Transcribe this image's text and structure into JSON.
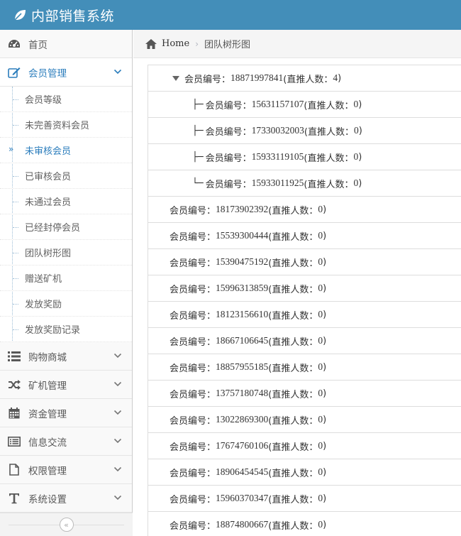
{
  "app": {
    "title": "内部销售系统"
  },
  "sidebar": {
    "items": [
      {
        "key": "dashboard",
        "label": "首页",
        "icon": "tachometer-icon"
      },
      {
        "key": "member",
        "label": "会员管理",
        "icon": "edit-icon",
        "open": true,
        "children": [
          {
            "label": "会员等级"
          },
          {
            "label": "未完善资料会员"
          },
          {
            "label": "未审核会员",
            "active": true
          },
          {
            "label": "已审核会员"
          },
          {
            "label": "未通过会员"
          },
          {
            "label": "已经封停会员"
          },
          {
            "label": "团队树形图"
          },
          {
            "label": "赠送矿机"
          },
          {
            "label": "发放奖励"
          },
          {
            "label": "发放奖励记录"
          }
        ]
      },
      {
        "key": "shop",
        "label": "购物商城",
        "icon": "list-icon"
      },
      {
        "key": "miner",
        "label": "矿机管理",
        "icon": "random-icon"
      },
      {
        "key": "funds",
        "label": "资金管理",
        "icon": "calendar-icon"
      },
      {
        "key": "message",
        "label": "信息交流",
        "icon": "list-alt-icon"
      },
      {
        "key": "permission",
        "label": "权限管理",
        "icon": "file-icon"
      },
      {
        "key": "settings",
        "label": "系统设置",
        "icon": "text-icon"
      }
    ],
    "collapse_glyph": "«"
  },
  "breadcrumbs": {
    "home": "Home",
    "separator": "›",
    "current": "团队树形图"
  },
  "tree": {
    "label_prefix": "会员编号：",
    "count_prefix": " (直推人数：",
    "count_suffix": ")",
    "rows": [
      {
        "type": "root",
        "id": "18871997841",
        "count": "4"
      },
      {
        "type": "child",
        "branch": "├─",
        "id": "15631157107",
        "count": "0"
      },
      {
        "type": "child",
        "branch": "├─",
        "id": "17330032003",
        "count": "0"
      },
      {
        "type": "child",
        "branch": "├─",
        "id": "15933119105",
        "count": "0"
      },
      {
        "type": "child",
        "branch": "└─",
        "id": "15933011925",
        "count": "0"
      },
      {
        "type": "flat",
        "id": "18173902392",
        "count": "0"
      },
      {
        "type": "flat",
        "id": "15539300444",
        "count": "0"
      },
      {
        "type": "flat",
        "id": "15390475192",
        "count": "0"
      },
      {
        "type": "flat",
        "id": "15996313859",
        "count": "0"
      },
      {
        "type": "flat",
        "id": "18123156610",
        "count": "0"
      },
      {
        "type": "flat",
        "id": "18667106645",
        "count": "0"
      },
      {
        "type": "flat",
        "id": "18857955185",
        "count": "0"
      },
      {
        "type": "flat",
        "id": "13757180748",
        "count": "0"
      },
      {
        "type": "flat",
        "id": "13022869300",
        "count": "0"
      },
      {
        "type": "flat",
        "id": "17674760106",
        "count": "0"
      },
      {
        "type": "flat",
        "id": "18906454545",
        "count": "0"
      },
      {
        "type": "flat",
        "id": "15960370347",
        "count": "0"
      },
      {
        "type": "flat",
        "id": "18874800667",
        "count": "0"
      }
    ]
  },
  "colors": {
    "navbar": "#438eb9",
    "accent": "#2b7dbc"
  }
}
